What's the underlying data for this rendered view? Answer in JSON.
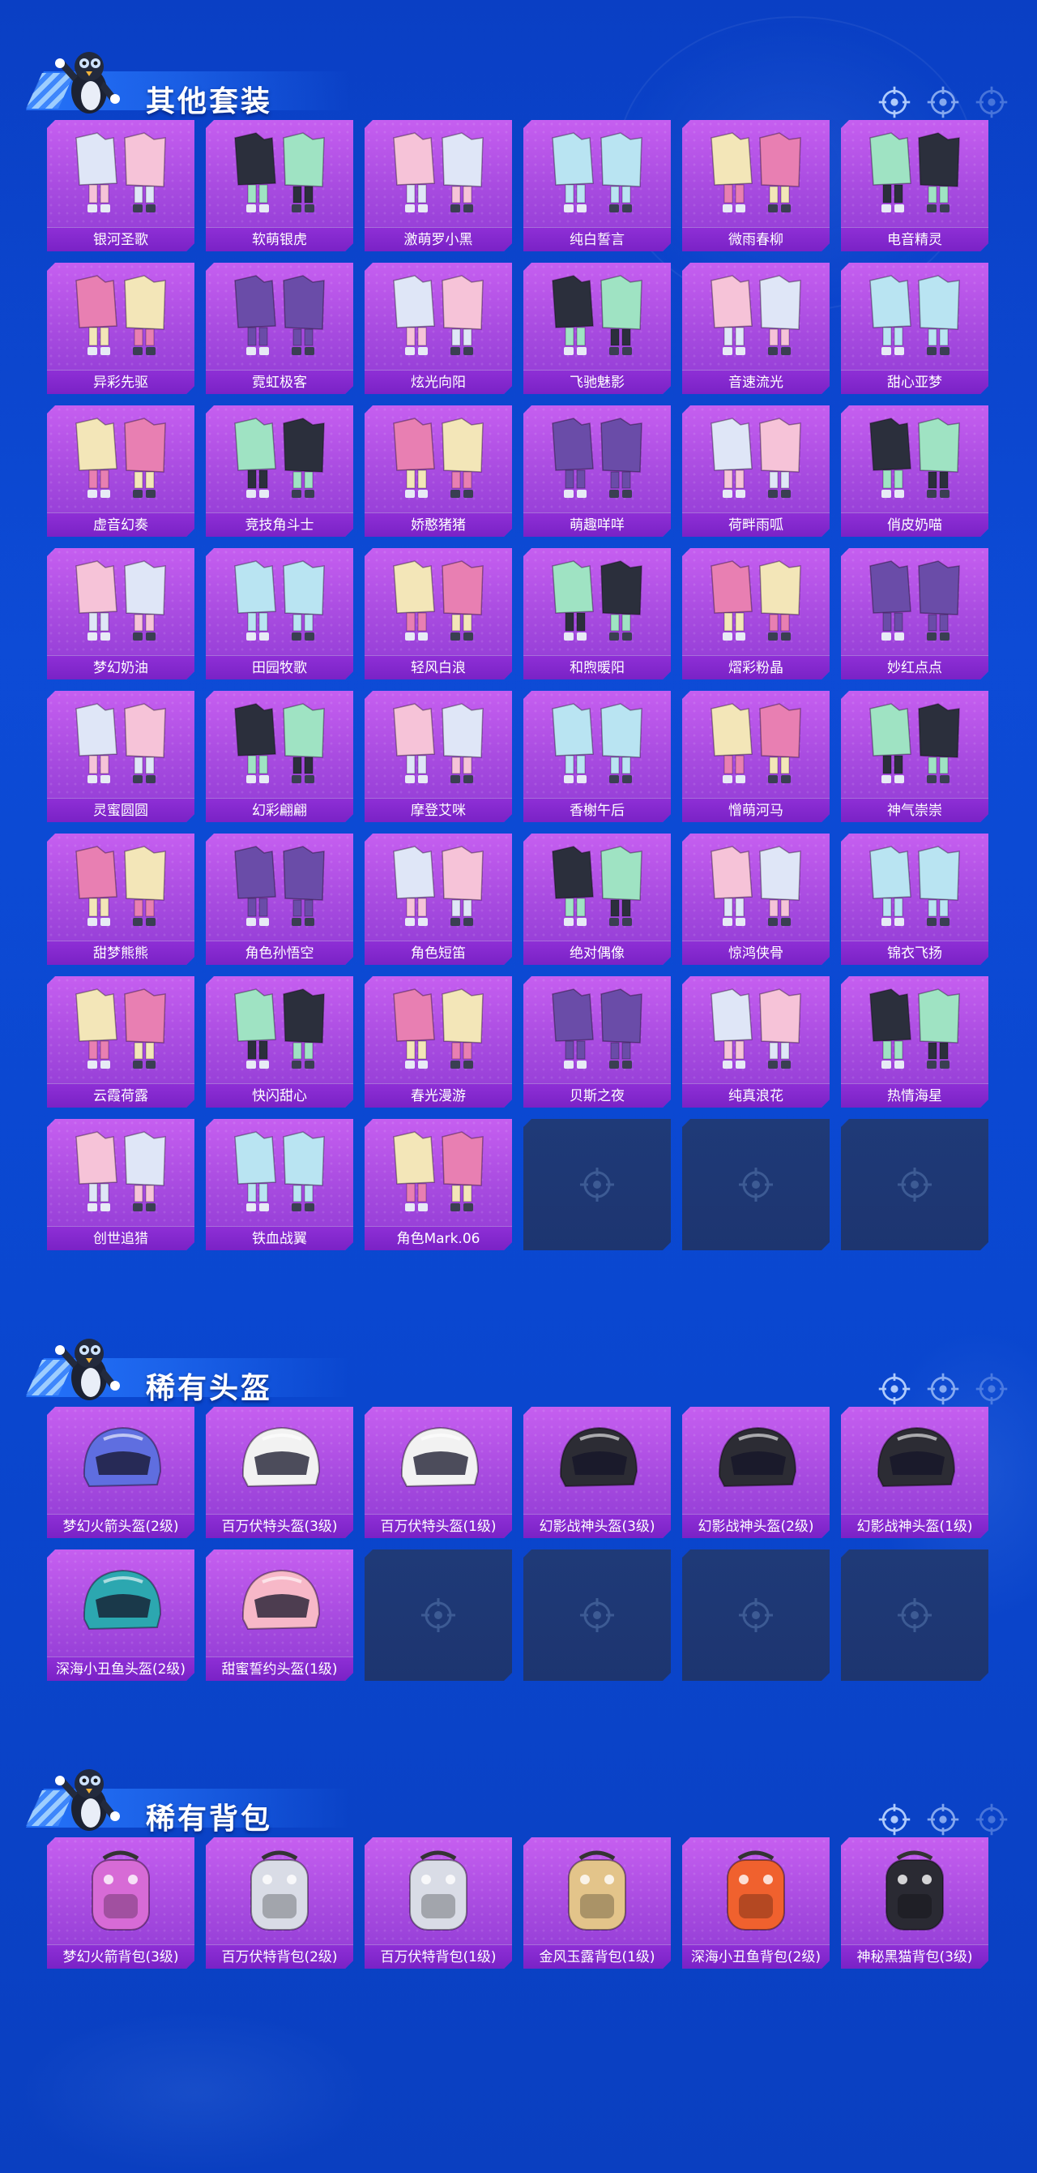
{
  "sections": [
    {
      "title": "其他套装",
      "items": [
        "银河圣歌",
        "软萌银虎",
        "激萌罗小黑",
        "纯白誓言",
        "微雨春柳",
        "电音精灵",
        "异彩先驱",
        "霓虹极客",
        "炫光向阳",
        "飞驰魅影",
        "音速流光",
        "甜心亚梦",
        "虚音幻奏",
        "竞技角斗士",
        "娇憨猪猪",
        "萌趣咩咩",
        "荷畔雨呱",
        "俏皮奶喵",
        "梦幻奶油",
        "田园牧歌",
        "轻风白浪",
        "和煦暖阳",
        "熠彩粉晶",
        "妙红点点",
        "灵蜜圆圆",
        "幻彩翩翩",
        "摩登艾咪",
        "香榭午后",
        "憎萌河马",
        "神气崇崇",
        "甜梦熊熊",
        "角色孙悟空",
        "角色短笛",
        "绝对偶像",
        "惊鸿侠骨",
        "锦衣飞扬",
        "云霞荷露",
        "快闪甜心",
        "春光漫游",
        "贝斯之夜",
        "纯真浪花",
        "热情海星",
        "创世追猎",
        "铁血战翼",
        "角色Mark.06",
        "",
        "",
        ""
      ]
    },
    {
      "title": "稀有头盔",
      "items": [
        "梦幻火箭头盔(2级)",
        "百万伏特头盔(3级)",
        "百万伏特头盔(1级)",
        "幻影战神头盔(3级)",
        "幻影战神头盔(2级)",
        "幻影战神头盔(1级)",
        "深海小丑鱼头盔(2级)",
        "甜蜜誓约头盔(1级)",
        "",
        "",
        "",
        ""
      ]
    },
    {
      "title": "稀有背包",
      "items": [
        "梦幻火箭背包(3级)",
        "百万伏特背包(2级)",
        "百万伏特背包(1级)",
        "金风玉露背包(1级)",
        "深海小丑鱼背包(2级)",
        "神秘黑猫背包(3级)"
      ]
    }
  ],
  "icons": {
    "section_mascot": "penguin-mascot-icon",
    "empty_slot": "crosshair-icon",
    "section_marks": "crosshair-icon"
  },
  "colors": {
    "background": "#0d4bd6",
    "card": "#b057e6",
    "card_label": "#7f26c9",
    "empty_card": "#1f3a78"
  }
}
